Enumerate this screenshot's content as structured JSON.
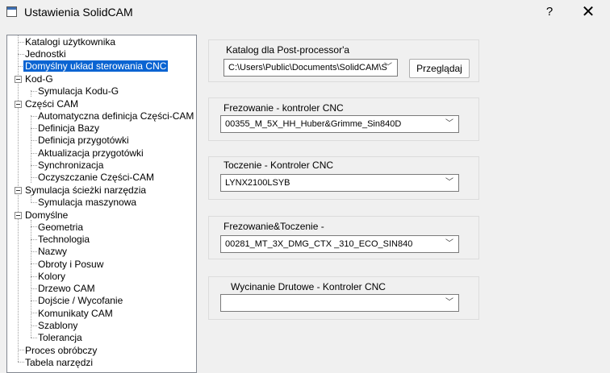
{
  "window": {
    "title": "Ustawienia SolidCAM",
    "help_glyph": "?",
    "close_glyph": "✕"
  },
  "tree": {
    "items": [
      {
        "label": "Katalogi użytkownika"
      },
      {
        "label": "Jednostki"
      },
      {
        "label": "Domyślny układ sterowania CNC",
        "selected": true
      },
      {
        "label": "Kod-G"
      },
      {
        "label": "Symulacja Kodu-G"
      },
      {
        "label": "Części CAM"
      },
      {
        "label": "Automatyczna definicja Części-CAM"
      },
      {
        "label": "Definicja Bazy"
      },
      {
        "label": "Definicja przygotówki"
      },
      {
        "label": "Aktualizacja przygotówki"
      },
      {
        "label": "Synchronizacja"
      },
      {
        "label": "Oczyszczanie Części-CAM"
      },
      {
        "label": "Symulacja ścieżki narzędzia"
      },
      {
        "label": "Symulacja maszynowa"
      },
      {
        "label": "Domyślne"
      },
      {
        "label": "Geometria"
      },
      {
        "label": "Technologia"
      },
      {
        "label": "Nazwy"
      },
      {
        "label": "Obroty i Posuw"
      },
      {
        "label": "Kolory"
      },
      {
        "label": "Drzewo CAM"
      },
      {
        "label": "Dojście / Wycofanie"
      },
      {
        "label": "Komunikaty CAM"
      },
      {
        "label": "Szablony"
      },
      {
        "label": "Tolerancja"
      },
      {
        "label": "Proces obróbczy"
      },
      {
        "label": "Tabela narzędzi"
      }
    ]
  },
  "postprocessor": {
    "label": "Katalog dla Post-processor'a",
    "path": "C:\\Users\\Public\\Documents\\SolidCAM\\S",
    "browse_label": "Przeglądaj"
  },
  "milling": {
    "label": "Frezowanie - kontroler CNC",
    "value": "00355_M_5X_HH_Huber&Grimme_Sin840D"
  },
  "turning": {
    "label": "Toczenie - Kontroler CNC",
    "value": "LYNX2100LSYB"
  },
  "millturn": {
    "label": "Frezowanie&Toczenie -",
    "value": "00281_MT_3X_DMG_CTX _310_ECO_SIN840"
  },
  "wirecut": {
    "label": "Wycinanie Drutowe - Kontroler CNC",
    "value": ""
  },
  "icons": {
    "dropdown": "﹀"
  }
}
